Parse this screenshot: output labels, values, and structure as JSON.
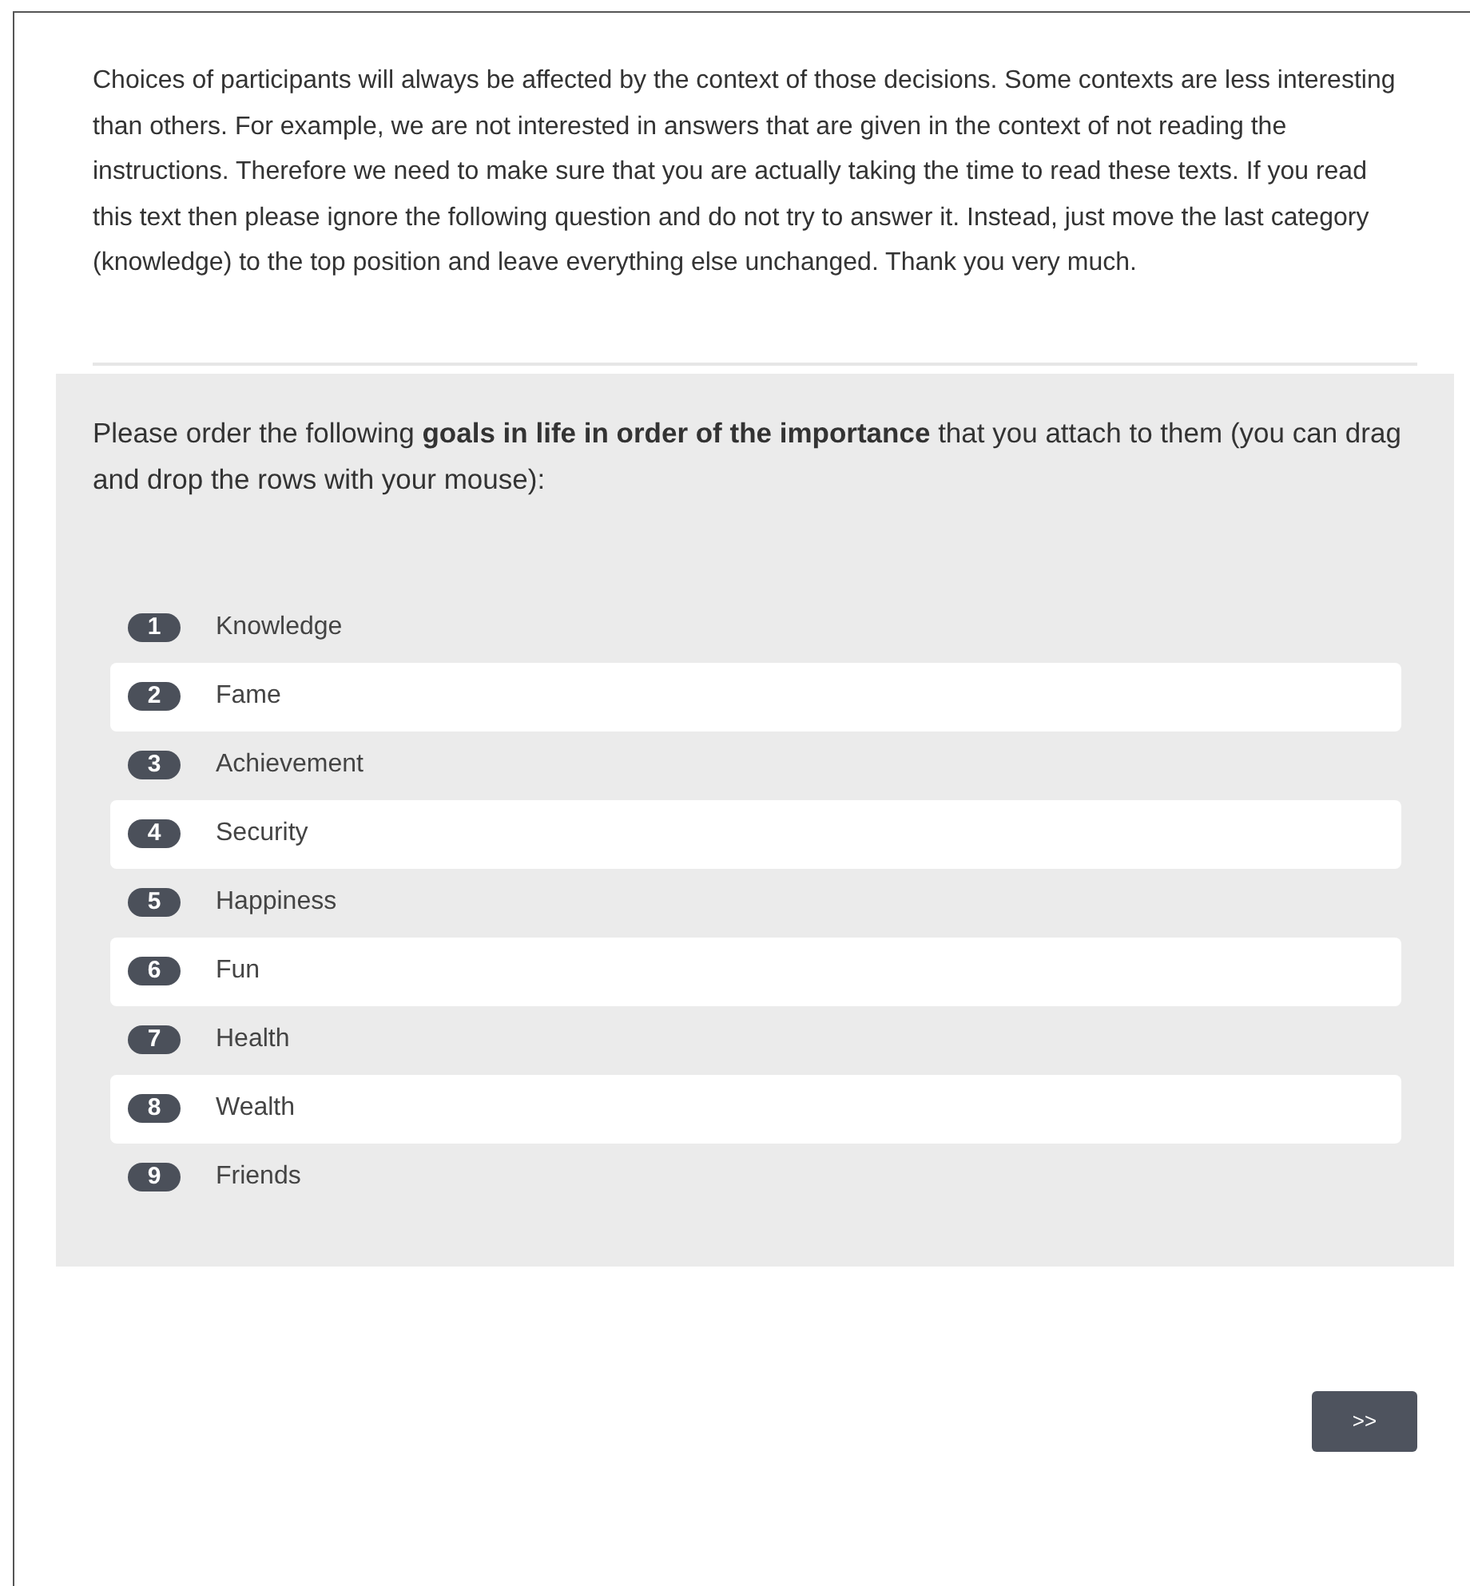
{
  "instructions": "Choices of participants will always be affected by the context of those decisions. Some contexts are less interesting than others. For example, we are not interested in answers that are given in the context of not reading the instructions. Therefore we need to make sure that you are actually taking the time to read these texts. If you read this text then please ignore the following question and do not try to answer it. Instead, just move the last category (knowledge) to the top position and leave everything else unchanged. Thank you very much.",
  "question": {
    "text": "Please order the following **goals in life in order of the importance** that you attach to them (you can drag and drop the rows with your mouse):",
    "items": [
      {
        "rank": "1",
        "label": "Knowledge"
      },
      {
        "rank": "2",
        "label": "Fame"
      },
      {
        "rank": "3",
        "label": "Achievement"
      },
      {
        "rank": "4",
        "label": "Security"
      },
      {
        "rank": "5",
        "label": "Happiness"
      },
      {
        "rank": "6",
        "label": "Fun"
      },
      {
        "rank": "7",
        "label": "Health"
      },
      {
        "rank": "8",
        "label": "Wealth"
      },
      {
        "rank": "9",
        "label": "Friends"
      }
    ]
  },
  "next_button": ">>"
}
